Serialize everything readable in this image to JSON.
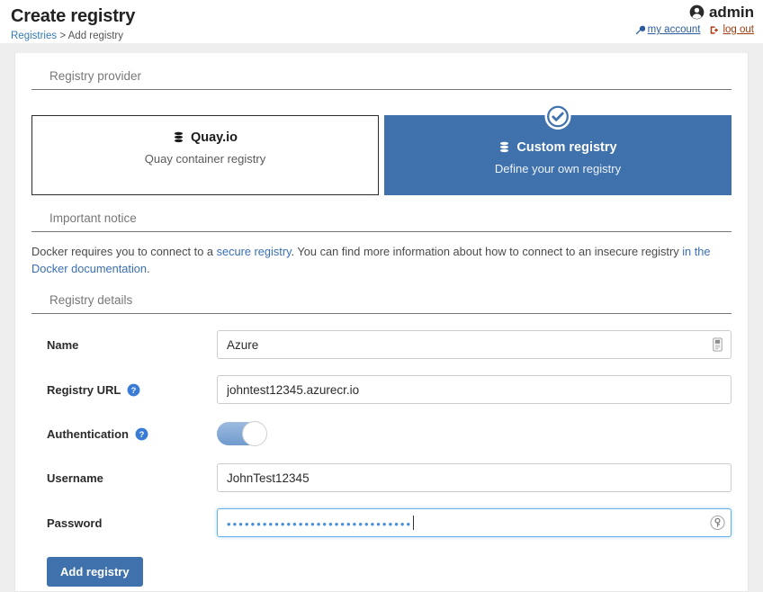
{
  "header": {
    "title": "Create registry",
    "breadcrumb": {
      "root": "Registries",
      "separator": ">",
      "current": "Add registry"
    },
    "user": {
      "name": "admin",
      "account_link": "my account",
      "logout_link": "log out"
    }
  },
  "sections": {
    "provider_title": "Registry provider",
    "notice_title": "Important notice",
    "details_title": "Registry details"
  },
  "providers": [
    {
      "title": "Quay.io",
      "subtitle": "Quay container registry",
      "selected": false
    },
    {
      "title": "Custom registry",
      "subtitle": "Define your own registry",
      "selected": true
    }
  ],
  "notice": {
    "part1": "Docker requires you to connect to a ",
    "link1": "secure registry",
    "part2": ". You can find more information about how to connect to an insecure registry ",
    "link2": "in the Docker documentation",
    "part3": "."
  },
  "form": {
    "name_label": "Name",
    "name_value": "Azure",
    "url_label": "Registry URL",
    "url_value": "johntest12345.azurecr.io",
    "auth_label": "Authentication",
    "auth_enabled": true,
    "username_label": "Username",
    "username_value": "JohnTest12345",
    "password_label": "Password",
    "password_masked": "•••••••••••••••••••••••••••••••"
  },
  "submit": {
    "label": "Add registry"
  },
  "colors": {
    "accent": "#3f72ad",
    "link": "#337ab7",
    "logout_link": "#9c3a10",
    "page_bg": "#eeeeee",
    "help_icon": "#3a7bd5"
  }
}
